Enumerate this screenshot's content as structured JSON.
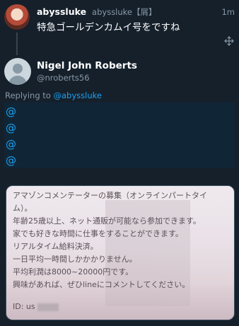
{
  "tweet": {
    "name": "abyssluke",
    "handle": "abyssluke【屑】",
    "time": "1m",
    "text": "特急ゴールデンカムイ号をですね"
  },
  "reply": {
    "name": "Nigel John Roberts",
    "handle": "@nroberts56",
    "replying_prefix": "Replying to ",
    "replying_to": "@abyssluke",
    "mentions": [
      "@",
      "@",
      "@",
      "@"
    ]
  },
  "card": {
    "lines": [
      "アマゾンコメンテーターの募集（オンラインパートタイ",
      "ム）。",
      "年齢25歳以上、ネット通販が可能なら参加できます。",
      "家でも好きな時間に仕事をすることができます。",
      "リアルタイム給料決済。",
      "一日平均一時間しかかかりません。",
      "平均利潤は8000~20000円です。",
      "興味があれば、ぜひlineにコメントしてください。"
    ],
    "id_label": "ID: us"
  },
  "icons": {
    "move": "move-icon",
    "avatar_original": "avatar",
    "avatar_reply": "default-avatar-icon"
  }
}
